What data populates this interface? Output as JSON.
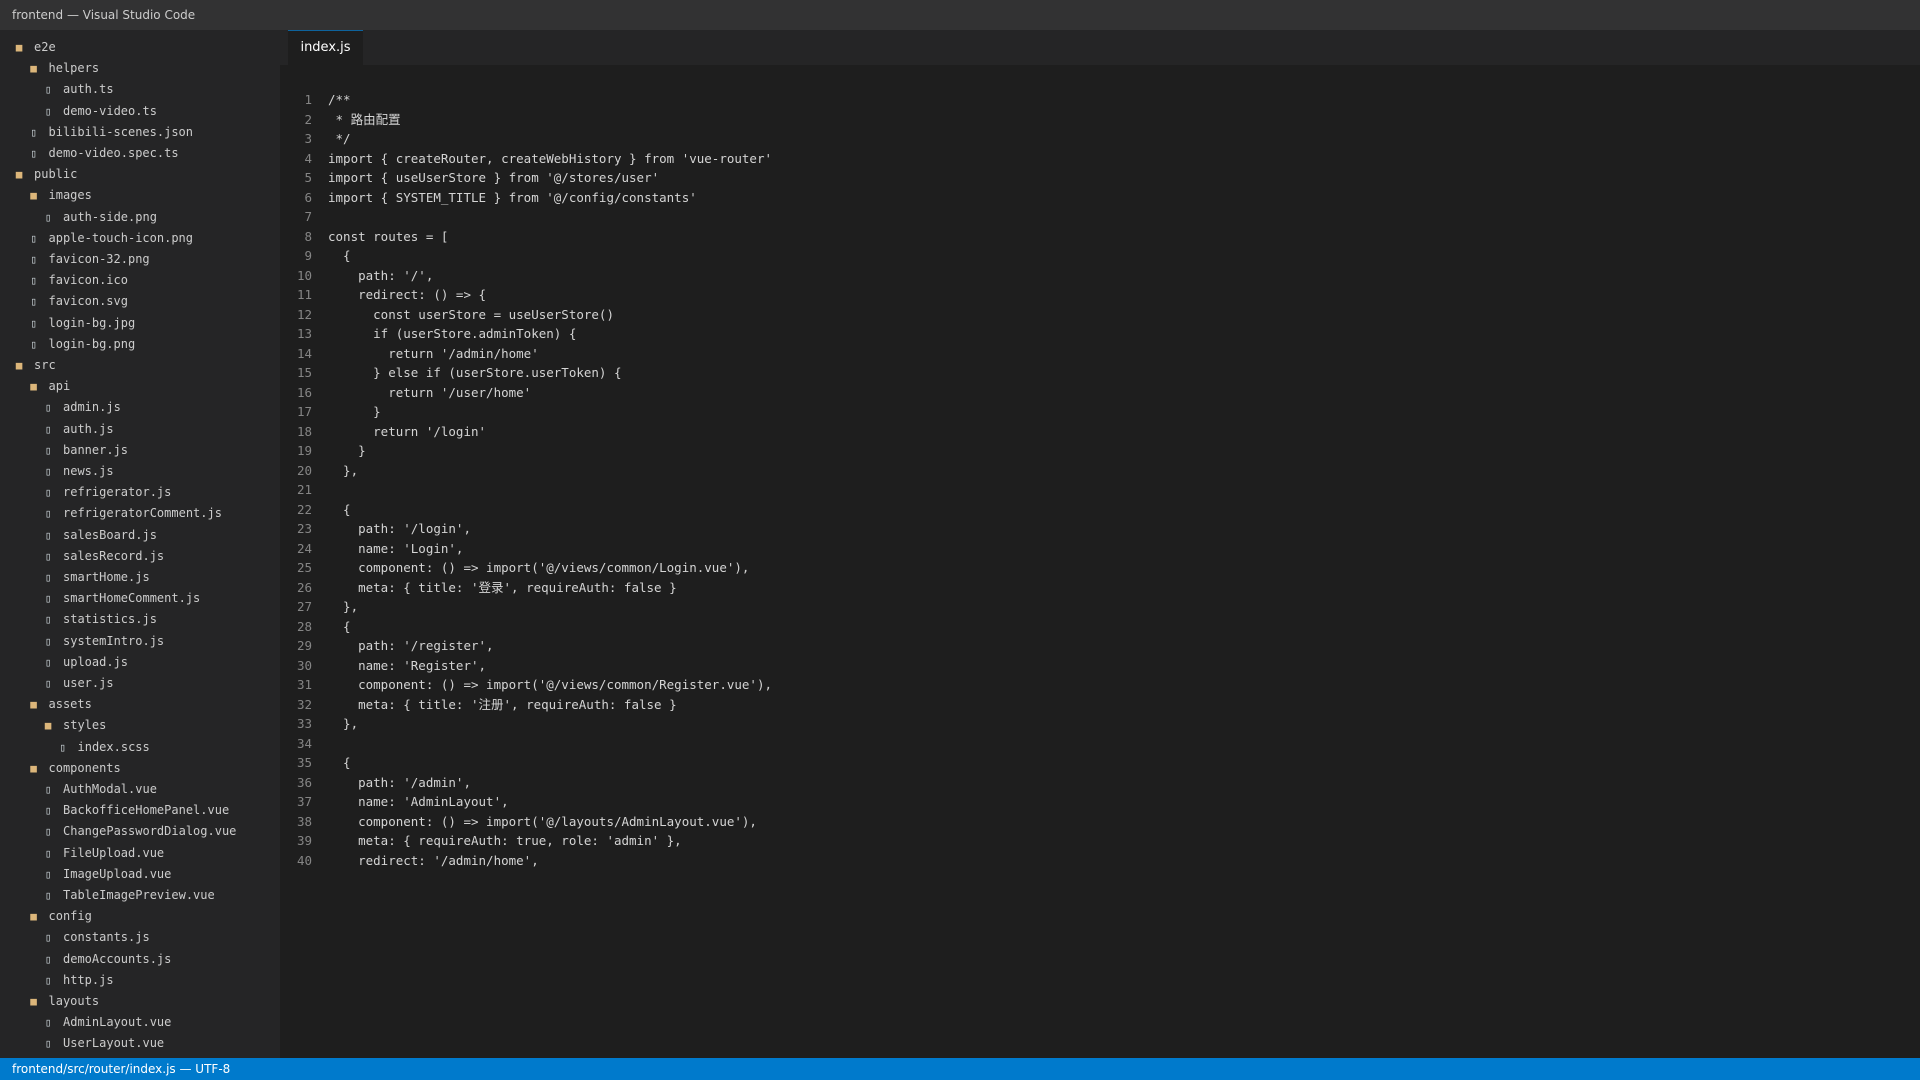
{
  "window": {
    "title": "frontend — Visual Studio Code"
  },
  "explorer": {
    "items": [
      {
        "label": "e2e",
        "type": "folder",
        "depth": 0
      },
      {
        "label": "helpers",
        "type": "folder",
        "depth": 1
      },
      {
        "label": "auth.ts",
        "type": "file",
        "depth": 2
      },
      {
        "label": "demo-video.ts",
        "type": "file",
        "depth": 2
      },
      {
        "label": "bilibili-scenes.json",
        "type": "file",
        "depth": 1
      },
      {
        "label": "demo-video.spec.ts",
        "type": "file",
        "depth": 1
      },
      {
        "label": "public",
        "type": "folder",
        "depth": 0
      },
      {
        "label": "images",
        "type": "folder",
        "depth": 1
      },
      {
        "label": "auth-side.png",
        "type": "file",
        "depth": 2
      },
      {
        "label": "apple-touch-icon.png",
        "type": "file",
        "depth": 1
      },
      {
        "label": "favicon-32.png",
        "type": "file",
        "depth": 1
      },
      {
        "label": "favicon.ico",
        "type": "file",
        "depth": 1
      },
      {
        "label": "favicon.svg",
        "type": "file",
        "depth": 1
      },
      {
        "label": "login-bg.jpg",
        "type": "file",
        "depth": 1
      },
      {
        "label": "login-bg.png",
        "type": "file",
        "depth": 1
      },
      {
        "label": "src",
        "type": "folder",
        "depth": 0
      },
      {
        "label": "api",
        "type": "folder",
        "depth": 1
      },
      {
        "label": "admin.js",
        "type": "file",
        "depth": 2
      },
      {
        "label": "auth.js",
        "type": "file",
        "depth": 2
      },
      {
        "label": "banner.js",
        "type": "file",
        "depth": 2
      },
      {
        "label": "news.js",
        "type": "file",
        "depth": 2
      },
      {
        "label": "refrigerator.js",
        "type": "file",
        "depth": 2
      },
      {
        "label": "refrigeratorComment.js",
        "type": "file",
        "depth": 2
      },
      {
        "label": "salesBoard.js",
        "type": "file",
        "depth": 2
      },
      {
        "label": "salesRecord.js",
        "type": "file",
        "depth": 2
      },
      {
        "label": "smartHome.js",
        "type": "file",
        "depth": 2
      },
      {
        "label": "smartHomeComment.js",
        "type": "file",
        "depth": 2
      },
      {
        "label": "statistics.js",
        "type": "file",
        "depth": 2
      },
      {
        "label": "systemIntro.js",
        "type": "file",
        "depth": 2
      },
      {
        "label": "upload.js",
        "type": "file",
        "depth": 2
      },
      {
        "label": "user.js",
        "type": "file",
        "depth": 2
      },
      {
        "label": "assets",
        "type": "folder",
        "depth": 1
      },
      {
        "label": "styles",
        "type": "folder",
        "depth": 2
      },
      {
        "label": "index.scss",
        "type": "file",
        "depth": 3
      },
      {
        "label": "components",
        "type": "folder",
        "depth": 1
      },
      {
        "label": "AuthModal.vue",
        "type": "file",
        "depth": 2
      },
      {
        "label": "BackofficeHomePanel.vue",
        "type": "file",
        "depth": 2
      },
      {
        "label": "ChangePasswordDialog.vue",
        "type": "file",
        "depth": 2
      },
      {
        "label": "FileUpload.vue",
        "type": "file",
        "depth": 2
      },
      {
        "label": "ImageUpload.vue",
        "type": "file",
        "depth": 2
      },
      {
        "label": "TableImagePreview.vue",
        "type": "file",
        "depth": 2
      },
      {
        "label": "config",
        "type": "folder",
        "depth": 1
      },
      {
        "label": "constants.js",
        "type": "file",
        "depth": 2
      },
      {
        "label": "demoAccounts.js",
        "type": "file",
        "depth": 2
      },
      {
        "label": "http.js",
        "type": "file",
        "depth": 2
      },
      {
        "label": "layouts",
        "type": "folder",
        "depth": 1
      },
      {
        "label": "AdminLayout.vue",
        "type": "file",
        "depth": 2
      },
      {
        "label": "UserLayout.vue",
        "type": "file",
        "depth": 2
      }
    ]
  },
  "editor": {
    "tabs": [
      {
        "label": "index.js",
        "active": true
      }
    ],
    "lines": [
      "/**",
      " * 路由配置",
      " */",
      "import { createRouter, createWebHistory } from 'vue-router'",
      "import { useUserStore } from '@/stores/user'",
      "import { SYSTEM_TITLE } from '@/config/constants'",
      "",
      "const routes = [",
      "  {",
      "    path: '/',",
      "    redirect: () => {",
      "      const userStore = useUserStore()",
      "      if (userStore.adminToken) {",
      "        return '/admin/home'",
      "      } else if (userStore.userToken) {",
      "        return '/user/home'",
      "      }",
      "      return '/login'",
      "    }",
      "  },",
      "",
      "  {",
      "    path: '/login',",
      "    name: 'Login',",
      "    component: () => import('@/views/common/Login.vue'),",
      "    meta: { title: '登录', requireAuth: false }",
      "  },",
      "  {",
      "    path: '/register',",
      "    name: 'Register',",
      "    component: () => import('@/views/common/Register.vue'),",
      "    meta: { title: '注册', requireAuth: false }",
      "  },",
      "",
      "  {",
      "    path: '/admin',",
      "    name: 'AdminLayout',",
      "    component: () => import('@/layouts/AdminLayout.vue'),",
      "    meta: { requireAuth: true, role: 'admin' },",
      "    redirect: '/admin/home',"
    ]
  },
  "statusbar": {
    "text": "frontend/src/router/index.js — UTF-8"
  },
  "colors": {
    "titlebar_bg": "#323233",
    "sidebar_bg": "#252526",
    "editor_bg": "#1e1e1e",
    "statusbar_bg": "#007acc",
    "folder_icon": "#dcb67a",
    "line_number": "#858585"
  }
}
